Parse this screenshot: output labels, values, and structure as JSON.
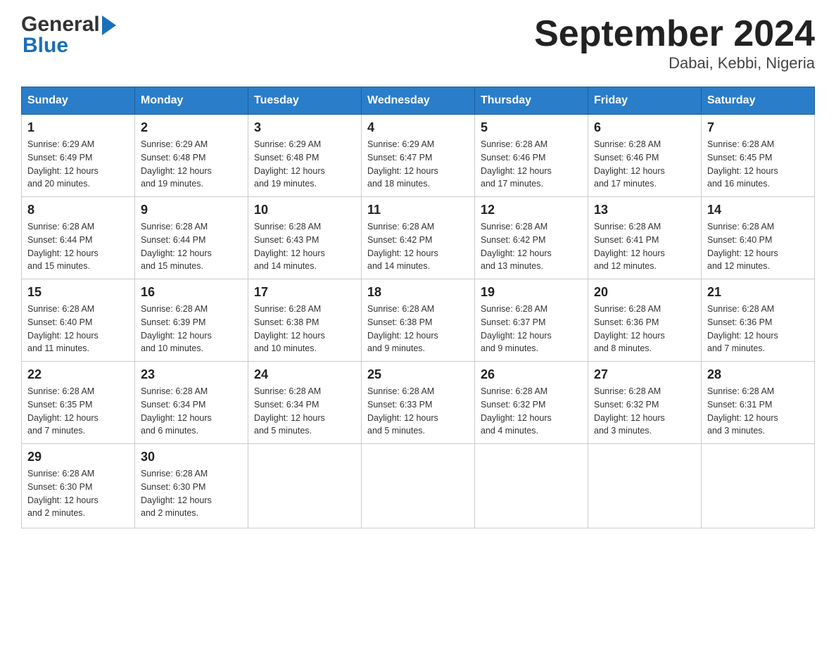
{
  "header": {
    "logo_general": "General",
    "logo_blue": "Blue",
    "title": "September 2024",
    "subtitle": "Dabai, Kebbi, Nigeria"
  },
  "days_of_week": [
    "Sunday",
    "Monday",
    "Tuesday",
    "Wednesday",
    "Thursday",
    "Friday",
    "Saturday"
  ],
  "weeks": [
    [
      {
        "day": "1",
        "sunrise": "6:29 AM",
        "sunset": "6:49 PM",
        "daylight": "12 hours and 20 minutes."
      },
      {
        "day": "2",
        "sunrise": "6:29 AM",
        "sunset": "6:48 PM",
        "daylight": "12 hours and 19 minutes."
      },
      {
        "day": "3",
        "sunrise": "6:29 AM",
        "sunset": "6:48 PM",
        "daylight": "12 hours and 19 minutes."
      },
      {
        "day": "4",
        "sunrise": "6:29 AM",
        "sunset": "6:47 PM",
        "daylight": "12 hours and 18 minutes."
      },
      {
        "day": "5",
        "sunrise": "6:28 AM",
        "sunset": "6:46 PM",
        "daylight": "12 hours and 17 minutes."
      },
      {
        "day": "6",
        "sunrise": "6:28 AM",
        "sunset": "6:46 PM",
        "daylight": "12 hours and 17 minutes."
      },
      {
        "day": "7",
        "sunrise": "6:28 AM",
        "sunset": "6:45 PM",
        "daylight": "12 hours and 16 minutes."
      }
    ],
    [
      {
        "day": "8",
        "sunrise": "6:28 AM",
        "sunset": "6:44 PM",
        "daylight": "12 hours and 15 minutes."
      },
      {
        "day": "9",
        "sunrise": "6:28 AM",
        "sunset": "6:44 PM",
        "daylight": "12 hours and 15 minutes."
      },
      {
        "day": "10",
        "sunrise": "6:28 AM",
        "sunset": "6:43 PM",
        "daylight": "12 hours and 14 minutes."
      },
      {
        "day": "11",
        "sunrise": "6:28 AM",
        "sunset": "6:42 PM",
        "daylight": "12 hours and 14 minutes."
      },
      {
        "day": "12",
        "sunrise": "6:28 AM",
        "sunset": "6:42 PM",
        "daylight": "12 hours and 13 minutes."
      },
      {
        "day": "13",
        "sunrise": "6:28 AM",
        "sunset": "6:41 PM",
        "daylight": "12 hours and 12 minutes."
      },
      {
        "day": "14",
        "sunrise": "6:28 AM",
        "sunset": "6:40 PM",
        "daylight": "12 hours and 12 minutes."
      }
    ],
    [
      {
        "day": "15",
        "sunrise": "6:28 AM",
        "sunset": "6:40 PM",
        "daylight": "12 hours and 11 minutes."
      },
      {
        "day": "16",
        "sunrise": "6:28 AM",
        "sunset": "6:39 PM",
        "daylight": "12 hours and 10 minutes."
      },
      {
        "day": "17",
        "sunrise": "6:28 AM",
        "sunset": "6:38 PM",
        "daylight": "12 hours and 10 minutes."
      },
      {
        "day": "18",
        "sunrise": "6:28 AM",
        "sunset": "6:38 PM",
        "daylight": "12 hours and 9 minutes."
      },
      {
        "day": "19",
        "sunrise": "6:28 AM",
        "sunset": "6:37 PM",
        "daylight": "12 hours and 9 minutes."
      },
      {
        "day": "20",
        "sunrise": "6:28 AM",
        "sunset": "6:36 PM",
        "daylight": "12 hours and 8 minutes."
      },
      {
        "day": "21",
        "sunrise": "6:28 AM",
        "sunset": "6:36 PM",
        "daylight": "12 hours and 7 minutes."
      }
    ],
    [
      {
        "day": "22",
        "sunrise": "6:28 AM",
        "sunset": "6:35 PM",
        "daylight": "12 hours and 7 minutes."
      },
      {
        "day": "23",
        "sunrise": "6:28 AM",
        "sunset": "6:34 PM",
        "daylight": "12 hours and 6 minutes."
      },
      {
        "day": "24",
        "sunrise": "6:28 AM",
        "sunset": "6:34 PM",
        "daylight": "12 hours and 5 minutes."
      },
      {
        "day": "25",
        "sunrise": "6:28 AM",
        "sunset": "6:33 PM",
        "daylight": "12 hours and 5 minutes."
      },
      {
        "day": "26",
        "sunrise": "6:28 AM",
        "sunset": "6:32 PM",
        "daylight": "12 hours and 4 minutes."
      },
      {
        "day": "27",
        "sunrise": "6:28 AM",
        "sunset": "6:32 PM",
        "daylight": "12 hours and 3 minutes."
      },
      {
        "day": "28",
        "sunrise": "6:28 AM",
        "sunset": "6:31 PM",
        "daylight": "12 hours and 3 minutes."
      }
    ],
    [
      {
        "day": "29",
        "sunrise": "6:28 AM",
        "sunset": "6:30 PM",
        "daylight": "12 hours and 2 minutes."
      },
      {
        "day": "30",
        "sunrise": "6:28 AM",
        "sunset": "6:30 PM",
        "daylight": "12 hours and 2 minutes."
      },
      null,
      null,
      null,
      null,
      null
    ]
  ],
  "labels": {
    "sunrise": "Sunrise:",
    "sunset": "Sunset:",
    "daylight": "Daylight:"
  }
}
